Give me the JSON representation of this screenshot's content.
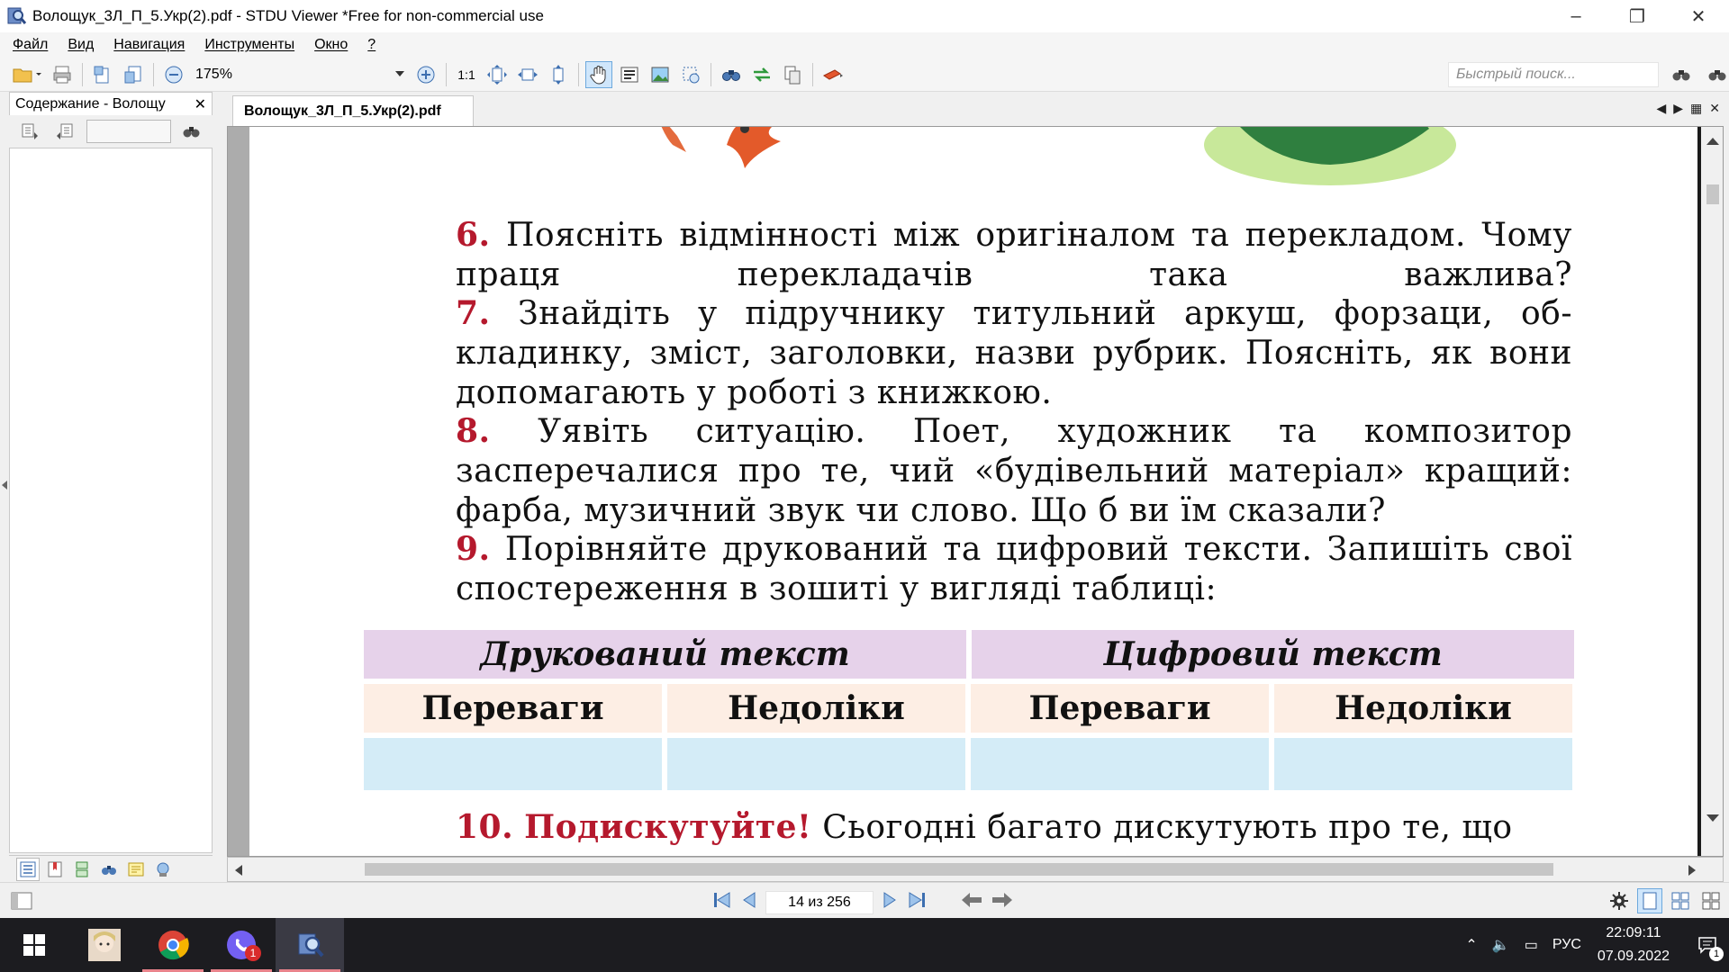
{
  "window": {
    "title": "Волощук_3Л_П_5.Укр(2).pdf - STDU Viewer *Free for non-commercial use",
    "minimize": "–",
    "restore": "❐",
    "close": "✕"
  },
  "menu": [
    "Файл",
    "Вид",
    "Навигация",
    "Инструменты",
    "Окно",
    "?"
  ],
  "toolbar": {
    "zoom_value": "175%",
    "one_to_one": "1:1",
    "quick_search_placeholder": "Быстрый поиск..."
  },
  "left_panel": {
    "tab_label": "Содержание - Волощу",
    "close": "✕"
  },
  "document": {
    "tab_label": "Волощук_3Л_П_5.Укр(2).pdf",
    "tasks": [
      {
        "num": "6.",
        "text": "Поясніть відмінності між оригіналом та перекладом. Чому праця перекладачів така важлива?"
      },
      {
        "num": "7.",
        "text": "Знайдіть у підручнику титульний аркуш, форзаци, об-кладинку, зміст, заголовки, назви рубрик. Поясніть, як вони допомагають у роботі з книжкою."
      },
      {
        "num": "8.",
        "text": "Уявіть ситуацію. Поет, художник та композитор засперечалися про те, чий «будівельний матеріал» кращий: фарба, музичний звук чи слово. Що б ви їм сказали?"
      },
      {
        "num": "9.",
        "text": "Порівняйте друкований та цифровий тексти. Запишіть свої спостереження в зошиті у вигляді таблиці:"
      }
    ],
    "table": {
      "groups": [
        "Друкований текст",
        "Цифровий текст"
      ],
      "columns": [
        "Переваги",
        "Недоліки",
        "Переваги",
        "Недоліки"
      ]
    },
    "task10": {
      "num": "10.",
      "head": "Подискутуйте!",
      "text": "Сьогодні багато дискутують про те, що"
    }
  },
  "status": {
    "page_indicator": "14 из 256"
  },
  "taskbar": {
    "language": "РУС",
    "time": "22:09:11",
    "date": "07.09.2022",
    "viber_badge": "1",
    "notif_badge": "1"
  },
  "colors": {
    "task_number": "#b5192d",
    "table_group_bg": "#e6d2ea",
    "table_header_bg": "#fdeee4",
    "table_empty_bg": "#d4ecf7"
  }
}
